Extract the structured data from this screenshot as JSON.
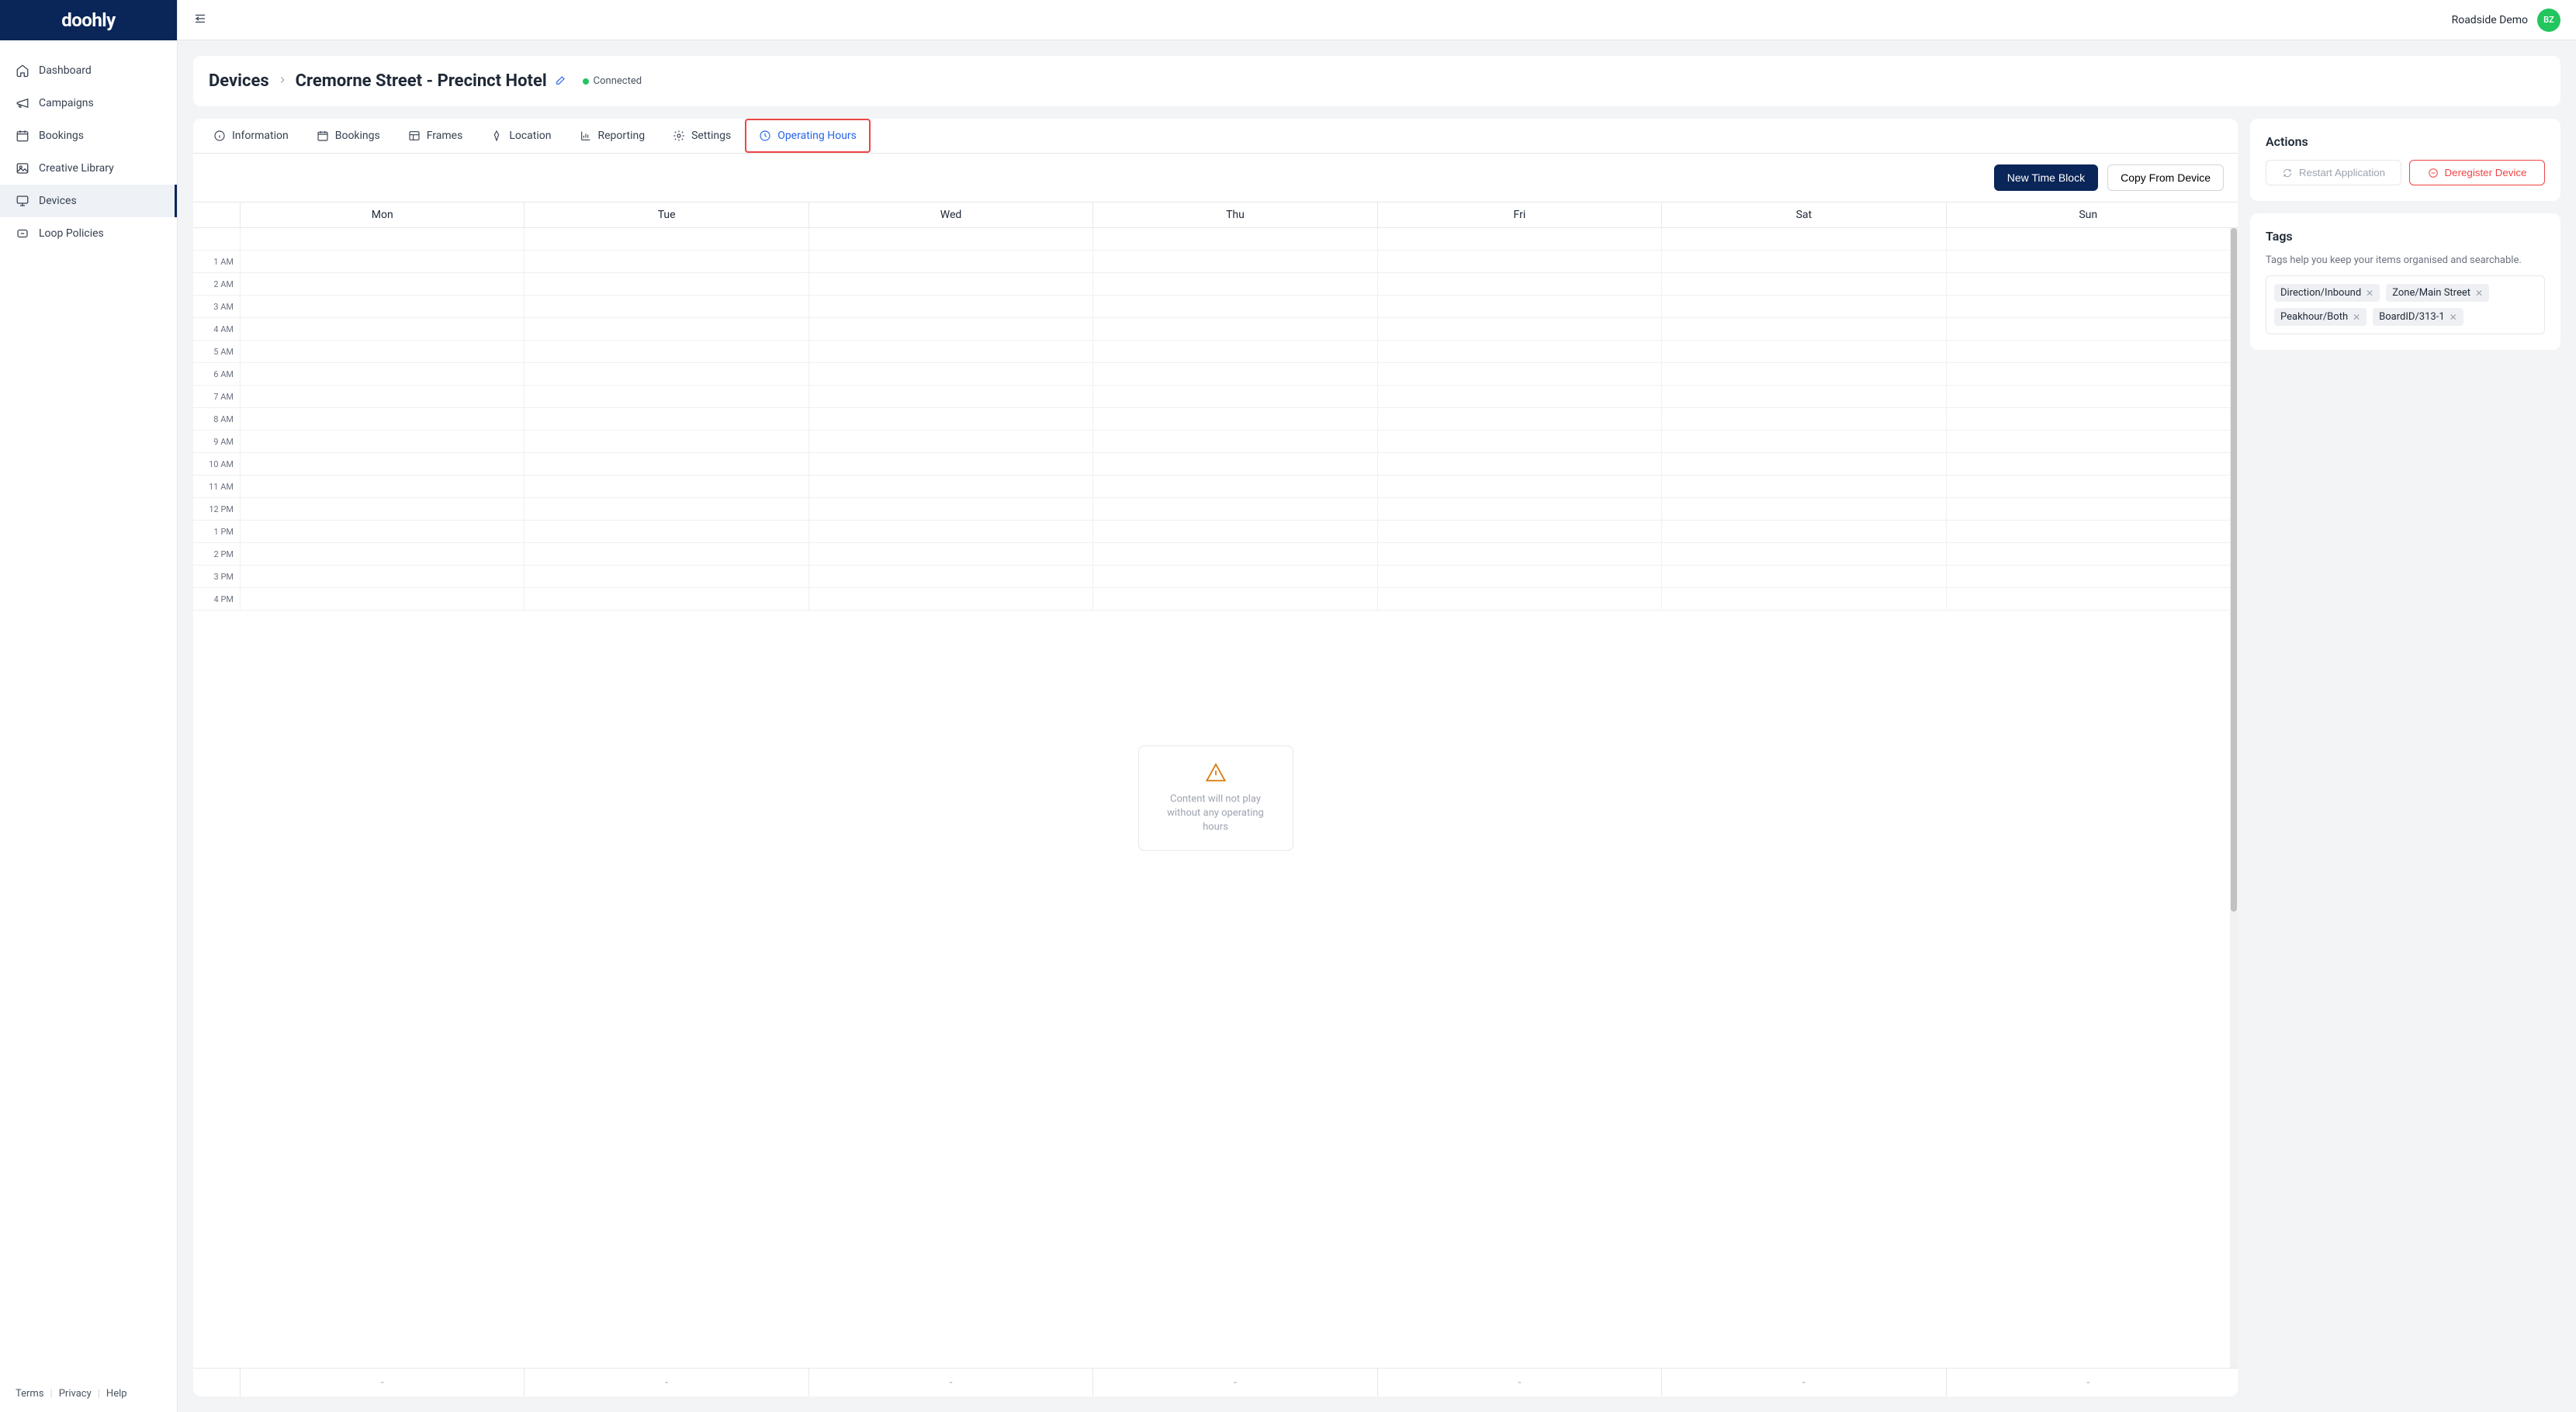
{
  "brand": "doohly",
  "account": {
    "name": "Roadside Demo",
    "initials": "BZ"
  },
  "sidebar": {
    "items": [
      {
        "label": "Dashboard",
        "icon": "home"
      },
      {
        "label": "Campaigns",
        "icon": "megaphone"
      },
      {
        "label": "Bookings",
        "icon": "calendar"
      },
      {
        "label": "Creative Library",
        "icon": "image"
      },
      {
        "label": "Devices",
        "icon": "monitor",
        "active": true
      },
      {
        "label": "Loop Policies",
        "icon": "loop"
      }
    ]
  },
  "footer": {
    "terms": "Terms",
    "privacy": "Privacy",
    "help": "Help"
  },
  "breadcrumb": {
    "root": "Devices",
    "current": "Cremorne Street - Precinct Hotel"
  },
  "status": {
    "label": "Connected"
  },
  "tabs": [
    {
      "label": "Information",
      "icon": "info"
    },
    {
      "label": "Bookings",
      "icon": "calendar"
    },
    {
      "label": "Frames",
      "icon": "layout"
    },
    {
      "label": "Location",
      "icon": "pin"
    },
    {
      "label": "Reporting",
      "icon": "chart"
    },
    {
      "label": "Settings",
      "icon": "gear"
    },
    {
      "label": "Operating Hours",
      "icon": "clock",
      "active": true,
      "highlighted": true
    }
  ],
  "toolbar": {
    "new_block": "New Time Block",
    "copy_from": "Copy From Device"
  },
  "schedule": {
    "days": [
      "Mon",
      "Tue",
      "Wed",
      "Thu",
      "Fri",
      "Sat",
      "Sun"
    ],
    "hours": [
      "1 AM",
      "2 AM",
      "3 AM",
      "4 AM",
      "5 AM",
      "6 AM",
      "7 AM",
      "8 AM",
      "9 AM",
      "10 AM",
      "11 AM",
      "12 PM",
      "1 PM",
      "2 PM",
      "3 PM",
      "4 PM"
    ],
    "empty_message": "Content will not play without any operating hours",
    "footer_vals": [
      "-",
      "-",
      "-",
      "-",
      "-",
      "-",
      "-"
    ]
  },
  "actions": {
    "title": "Actions",
    "restart": "Restart Application",
    "deregister": "Deregister Device"
  },
  "tags": {
    "title": "Tags",
    "help": "Tags help you keep your items organised and searchable.",
    "items": [
      "Direction/Inbound",
      "Zone/Main Street",
      "Peakhour/Both",
      "BoardID/313-1"
    ]
  }
}
